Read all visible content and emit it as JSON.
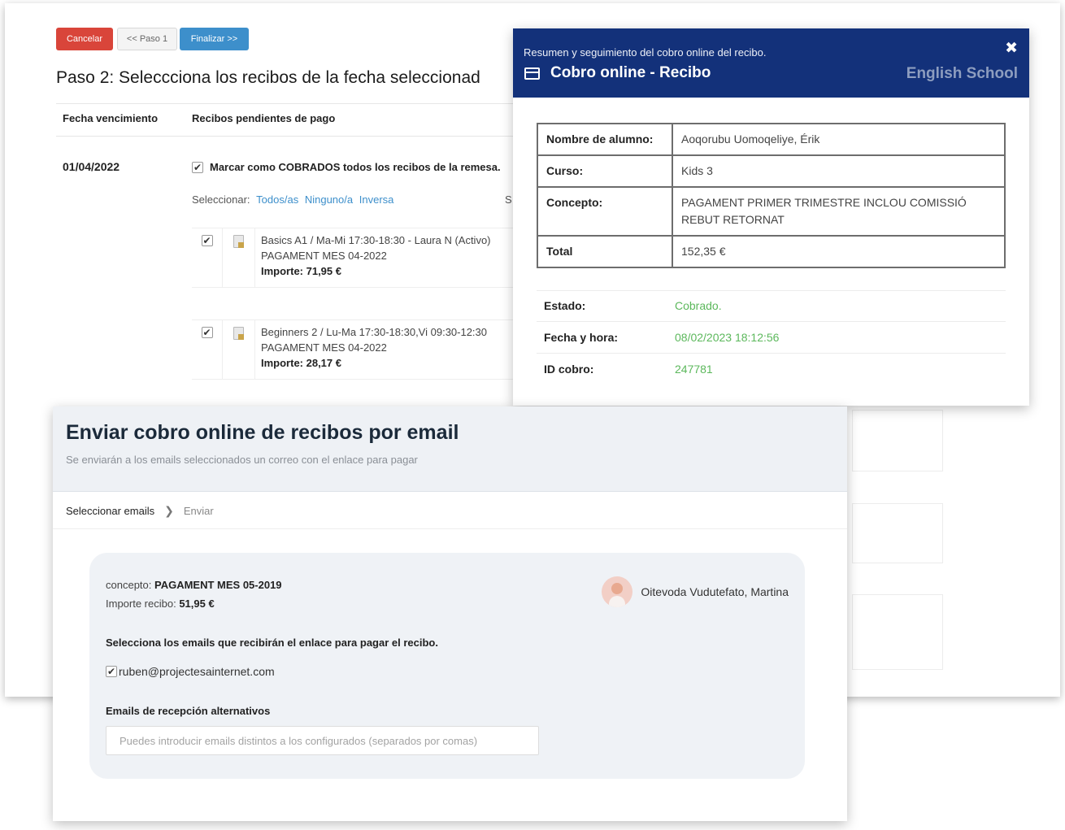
{
  "step2": {
    "buttons": {
      "cancel": "Cancelar",
      "prev": "<< Paso 1",
      "finish": "Finalizar >>"
    },
    "title": "Paso 2: Seleccciona los recibos de la fecha seleccionad",
    "columns": {
      "due_date": "Fecha vencimiento",
      "pending": "Recibos pendientes de pago"
    },
    "due_date": "01/04/2022",
    "mark_all": "Marcar como COBRADOS todos los recibos de la remesa.",
    "select": {
      "label": "Seleccionar:",
      "all": "Todos/as",
      "none": "Ninguno/a",
      "inverse": "Inversa",
      "cut": "S"
    },
    "receipts": [
      {
        "checked": true,
        "course": "Basics A1 / Ma-Mi 17:30-18:30 - Laura N (Activo)",
        "concept": "PAGAMENT MES 04-2022",
        "amount": "Importe: 71,95 €"
      },
      {
        "checked": true,
        "course": "Beginners 2 / Lu-Ma 17:30-18:30,Vi 09:30-12:30",
        "concept": "PAGAMENT MES 04-2022",
        "amount": "Importe: 28,17 €"
      }
    ]
  },
  "modal": {
    "subtitle": "Resumen y seguimiento del cobro online del recibo.",
    "title": "Cobro online - Recibo",
    "brand": "English School",
    "close": "✖",
    "rows": [
      {
        "label": "Nombre de alumno:",
        "value": "Aoqorubu Uomoqeliye, Érik"
      },
      {
        "label": "Curso:",
        "value": "Kids 3"
      },
      {
        "label": "Concepto:",
        "value": "PAGAMENT PRIMER TRIMESTRE INCLOU COMISSIÓ REBUT RETORNAT"
      },
      {
        "label": "Total",
        "value": "152,35 €"
      }
    ],
    "status": [
      {
        "label": "Estado:",
        "value": "Cobrado."
      },
      {
        "label": "Fecha y hora:",
        "value": "08/02/2023 18:12:56"
      },
      {
        "label": "ID cobro:",
        "value": "247781"
      }
    ],
    "status_color": "#5cb85c",
    "header_color": "#13317a"
  },
  "email_panel": {
    "title": "Enviar cobro online de recibos por email",
    "subtitle": "Se enviarán a los emails seleccionados un correo con el enlace para pagar",
    "breadcrumb": {
      "step1": "Seleccionar emails",
      "step2": "Enviar"
    },
    "concept_label": "concepto:",
    "concept_value": "PAGAMENT MES 05-2019",
    "amount_label": "Importe recibo:",
    "amount_value": "51,95 €",
    "student_name": "Oitevoda Vudutefato, Martina",
    "emails_title": "Selecciona los emails que recibirán el enlace para pagar el recibo.",
    "email_option": {
      "checked": true,
      "address": "ruben@projectesainternet.com"
    },
    "alt_title": "Emails de recepción alternativos",
    "alt_placeholder": "Puedes introducir emails distintos a los configurados (separados por comas)"
  }
}
